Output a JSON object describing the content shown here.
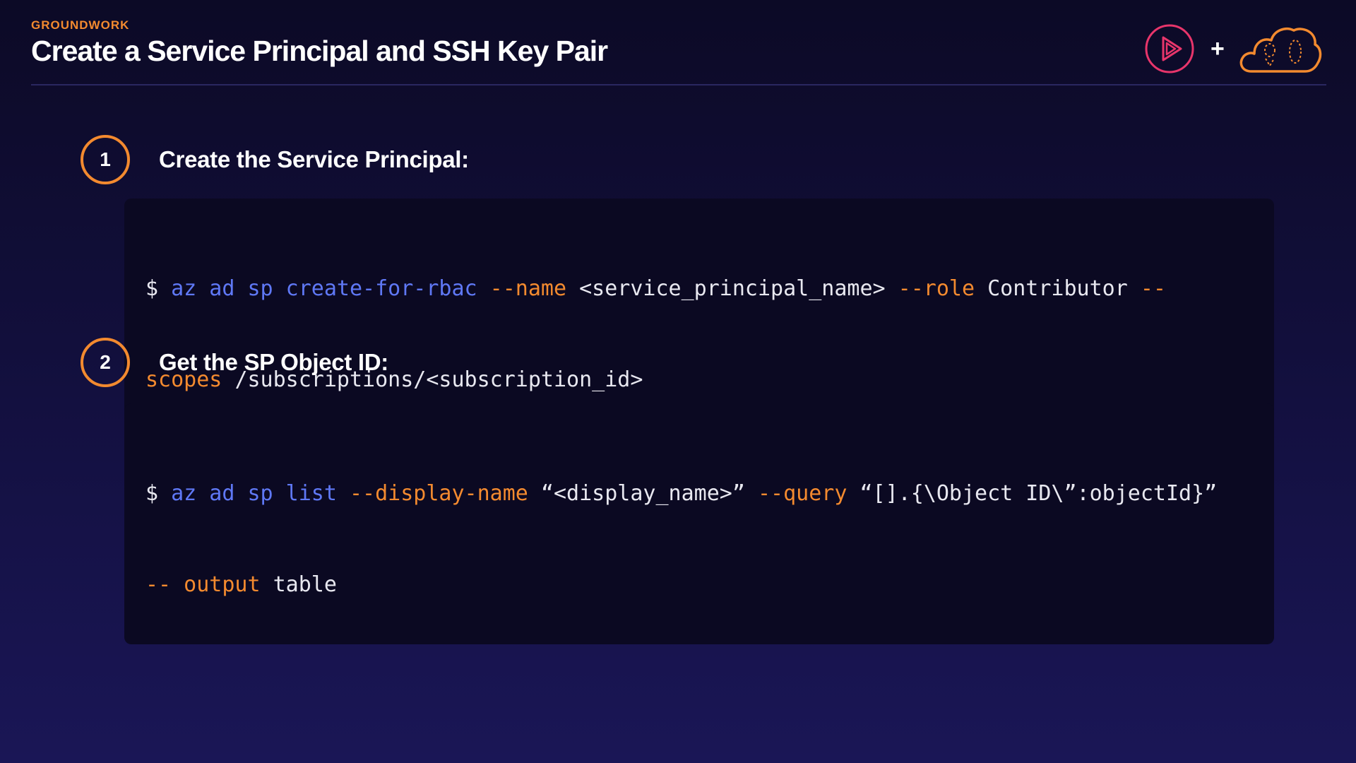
{
  "header": {
    "eyebrow": "GROUNDWORK",
    "title": "Create a Service Principal and SSH Key Pair",
    "logos": {
      "left_icon": "play-icon",
      "plus": "+",
      "right_icon": "cloud-icon"
    }
  },
  "colors": {
    "accent_orange": "#f38a2f",
    "command_blue": "#5f78f5",
    "play_logo_pink": "#e8356b",
    "background": "#120f3c",
    "code_background": "#0b0922"
  },
  "steps": [
    {
      "number": "1",
      "label": "Create the Service Principal:",
      "code_lines": [
        [
          {
            "type": "prompt",
            "text": "$ "
          },
          {
            "type": "cmd",
            "text": "az ad sp create-for-rbac "
          },
          {
            "type": "flag",
            "text": "--name "
          },
          {
            "type": "arg",
            "text": "<service_principal_name> "
          },
          {
            "type": "flag",
            "text": "--role "
          },
          {
            "type": "arg",
            "text": "Contributor "
          },
          {
            "type": "flag",
            "text": "--"
          }
        ],
        [
          {
            "type": "flag",
            "text": "scopes "
          },
          {
            "type": "arg",
            "text": "/subscriptions/<subscription_id>"
          }
        ]
      ]
    },
    {
      "number": "2",
      "label": "Get the SP Object ID:",
      "code_lines": [
        [
          {
            "type": "prompt",
            "text": "$ "
          },
          {
            "type": "cmd",
            "text": "az ad sp list "
          },
          {
            "type": "flag",
            "text": "--display-name "
          },
          {
            "type": "arg",
            "text": "“<display_name>” "
          },
          {
            "type": "flag",
            "text": "--query "
          },
          {
            "type": "arg",
            "text": "“[].{\\Object ID\\”:objectId}”"
          }
        ],
        [
          {
            "type": "flag",
            "text": "-- output "
          },
          {
            "type": "arg",
            "text": "table"
          }
        ]
      ]
    }
  ]
}
